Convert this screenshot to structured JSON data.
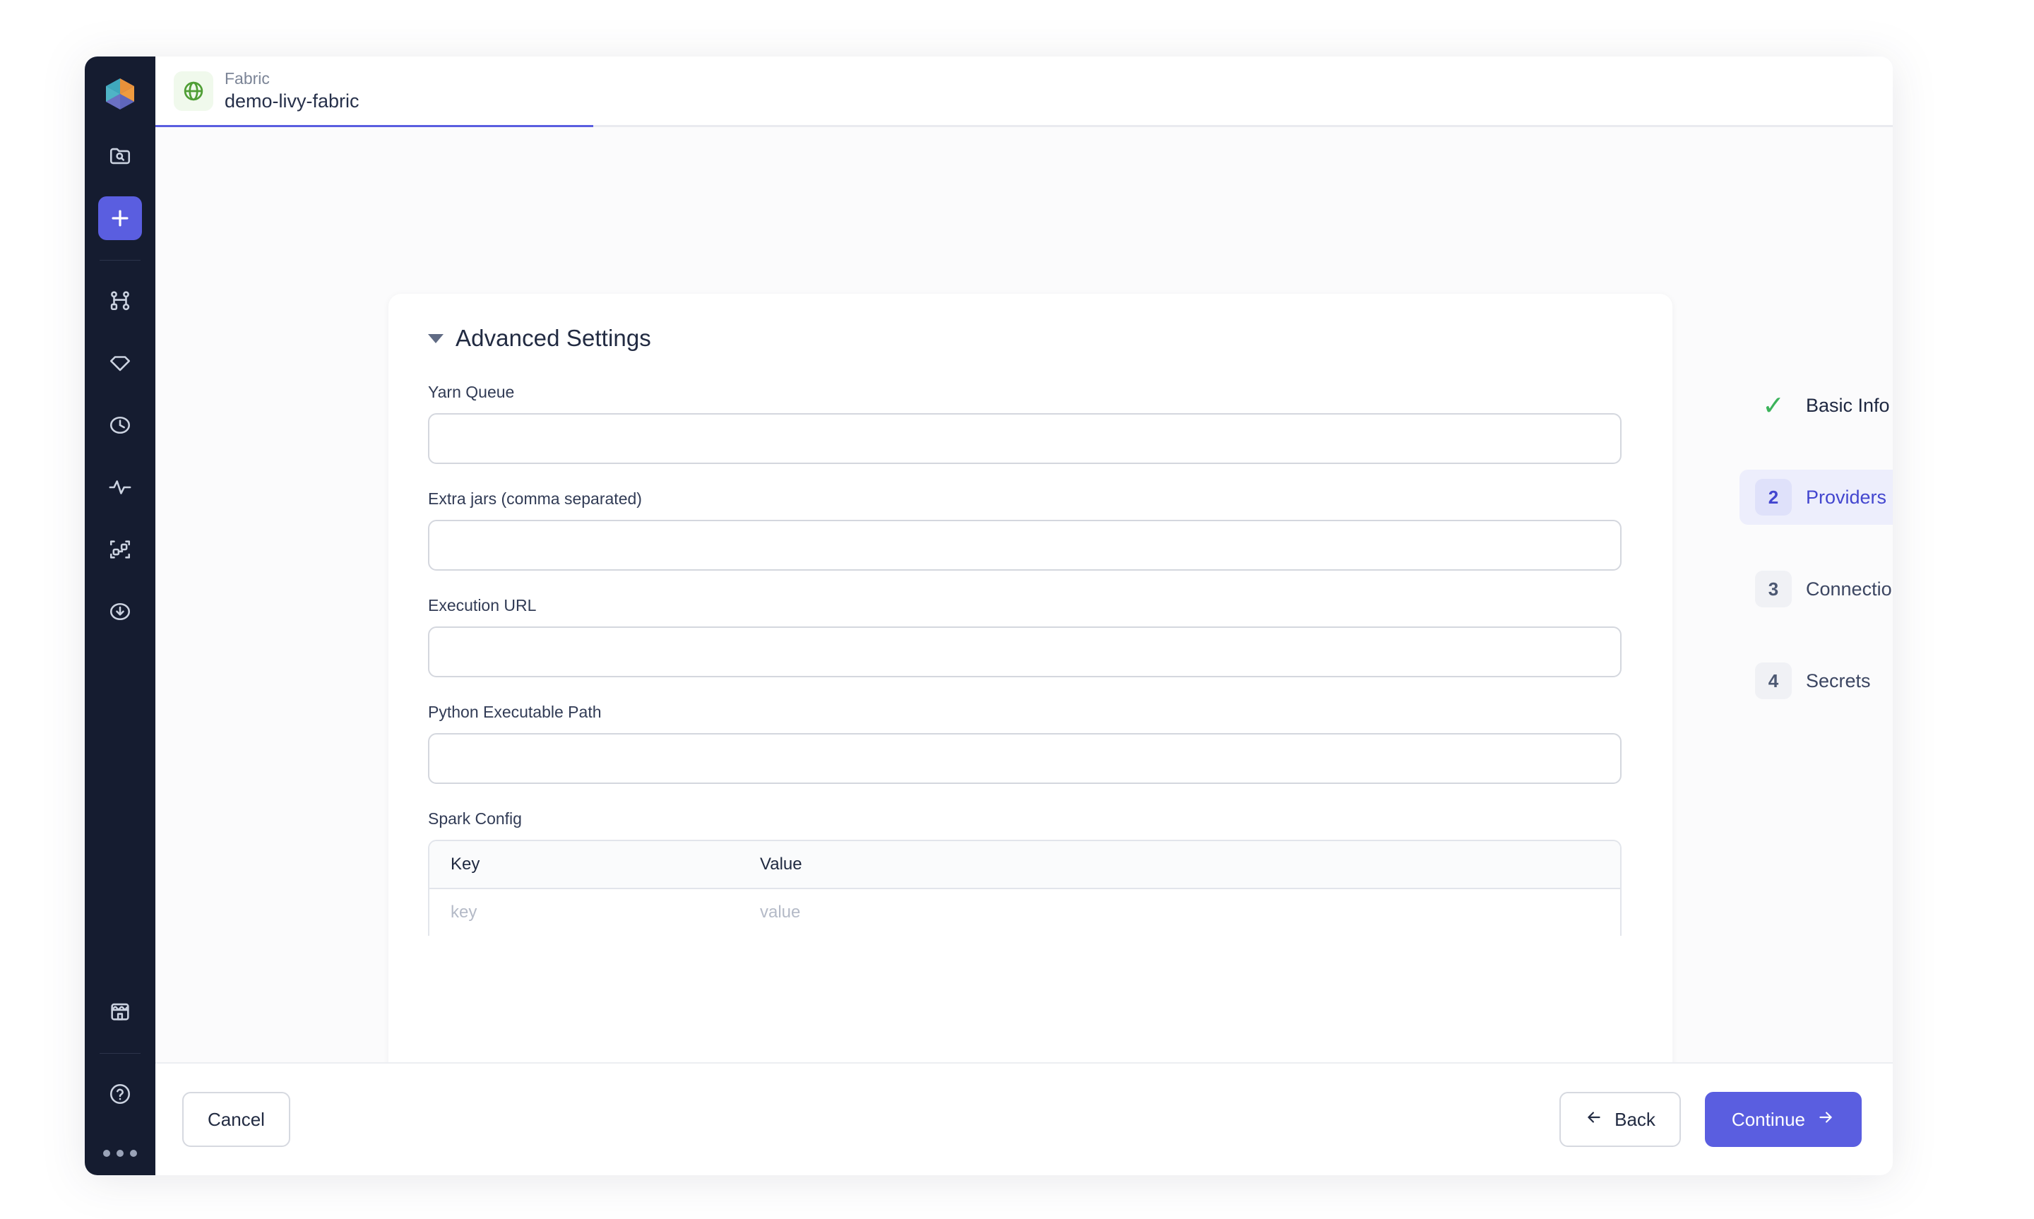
{
  "window": {
    "sidebar": {
      "logo_name": "prophecy-logo",
      "items": [
        {
          "name": "browse-projects",
          "icon": "folder-search-icon",
          "active": false
        },
        {
          "name": "create-new",
          "icon": "plus-icon",
          "active": true
        },
        {
          "name": "pipelines",
          "icon": "pipeline-nodes-icon",
          "active": false
        },
        {
          "name": "gems",
          "icon": "gem-icon",
          "active": false
        },
        {
          "name": "jobs-history",
          "icon": "clock-icon",
          "active": false
        },
        {
          "name": "monitoring",
          "icon": "activity-pulse-icon",
          "active": false
        },
        {
          "name": "lineage",
          "icon": "data-flow-icon",
          "active": false
        },
        {
          "name": "deployments",
          "icon": "download-circle-icon",
          "active": false
        },
        {
          "name": "marketplace",
          "icon": "store-icon",
          "active": false
        },
        {
          "name": "help",
          "icon": "question-circle-icon",
          "active": false
        },
        {
          "name": "more-options",
          "icon": "ellipsis-icon",
          "active": false
        }
      ]
    },
    "tab": {
      "kind": "Fabric",
      "name": "demo-livy-fabric",
      "icon": "globe-icon",
      "icon_color": "#4f9e35",
      "icon_bg": "#f0f9ec",
      "active_underline_color": "#5a5ee0"
    }
  },
  "settings": {
    "section_title": "Advanced Settings",
    "collapsed": false,
    "fields": [
      {
        "label": "Yarn Queue",
        "value": "",
        "placeholder": ""
      },
      {
        "label": "Extra jars (comma separated)",
        "value": "",
        "placeholder": ""
      },
      {
        "label": "Execution URL",
        "value": "",
        "placeholder": ""
      },
      {
        "label": "Python Executable Path",
        "value": "",
        "placeholder": ""
      }
    ],
    "spark_config": {
      "label": "Spark Config",
      "columns": [
        "Key",
        "Value"
      ],
      "rows": [
        {
          "key_placeholder": "key",
          "value_placeholder": "value"
        }
      ]
    }
  },
  "stepper": {
    "steps": [
      {
        "marker": "✓",
        "label": "Basic Info",
        "state": "done"
      },
      {
        "marker": "2",
        "label": "Providers",
        "state": "current"
      },
      {
        "marker": "3",
        "label": "Connections",
        "state": "upcoming"
      },
      {
        "marker": "4",
        "label": "Secrets",
        "state": "upcoming"
      }
    ]
  },
  "footer": {
    "cancel_label": "Cancel",
    "back_label": "Back",
    "continue_label": "Continue",
    "primary_color": "#5a5ee0"
  }
}
